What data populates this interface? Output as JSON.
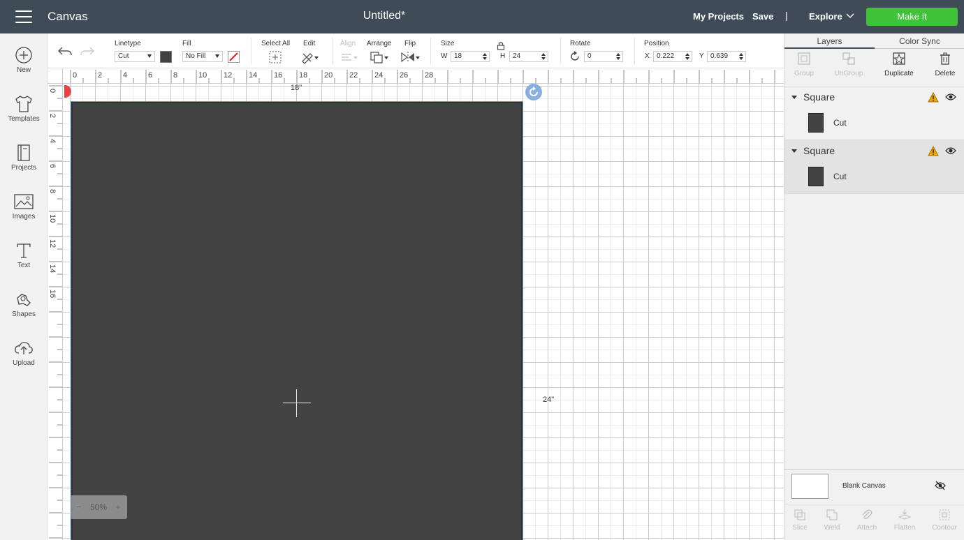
{
  "header": {
    "app_title": "Canvas",
    "doc_title": "Untitled*",
    "my_projects": "My Projects",
    "save": "Save",
    "divider": "|",
    "explore": "Explore",
    "make_it": "Make It"
  },
  "sidebar": {
    "items": [
      {
        "label": "New",
        "icon": "plus-circle-icon"
      },
      {
        "label": "Templates",
        "icon": "tshirt-icon"
      },
      {
        "label": "Projects",
        "icon": "notebook-icon"
      },
      {
        "label": "Images",
        "icon": "image-icon"
      },
      {
        "label": "Text",
        "icon": "text-icon"
      },
      {
        "label": "Shapes",
        "icon": "shapes-icon"
      },
      {
        "label": "Upload",
        "icon": "cloud-upload-icon"
      }
    ]
  },
  "toolbar": {
    "linetype_label": "Linetype",
    "linetype_value": "Cut",
    "fill_label": "Fill",
    "fill_value": "No Fill",
    "select_all_label": "Select All",
    "edit_label": "Edit",
    "align_label": "Align",
    "arrange_label": "Arrange",
    "flip_label": "Flip",
    "size_label": "Size",
    "w_label": "W",
    "w_value": "18",
    "h_label": "H",
    "h_value": "24",
    "rotate_label": "Rotate",
    "rotate_value": "0",
    "position_label": "Position",
    "x_label": "X",
    "x_value": "0.222",
    "y_label": "Y",
    "y_value": "0.639",
    "linetype_color": "#404040"
  },
  "rulers": {
    "top_ticks": [
      "0",
      "2",
      "4",
      "6",
      "8",
      "10",
      "12",
      "14",
      "16",
      "18",
      "20",
      "22",
      "24",
      "26",
      "28"
    ],
    "left_ticks": [
      "0",
      "2",
      "4",
      "6",
      "8",
      "10",
      "12",
      "14",
      "16"
    ]
  },
  "canvas": {
    "width_label": "18\"",
    "height_label": "24\"",
    "zoom_value": "50%",
    "zoom_out": "−",
    "zoom_in": "+",
    "design_color": "#434343"
  },
  "right_panel": {
    "tabs": [
      "Layers",
      "Color Sync"
    ],
    "actions": [
      {
        "label": "Group",
        "enabled": false
      },
      {
        "label": "UnGroup",
        "enabled": false
      },
      {
        "label": "Duplicate",
        "enabled": true
      },
      {
        "label": "Delete",
        "enabled": true
      }
    ],
    "layers": [
      {
        "name": "Square",
        "type": "Cut"
      },
      {
        "name": "Square",
        "type": "Cut"
      }
    ],
    "blank_canvas": "Blank Canvas",
    "bottom_tools": [
      "Slice",
      "Weld",
      "Attach",
      "Flatten",
      "Contour"
    ]
  }
}
